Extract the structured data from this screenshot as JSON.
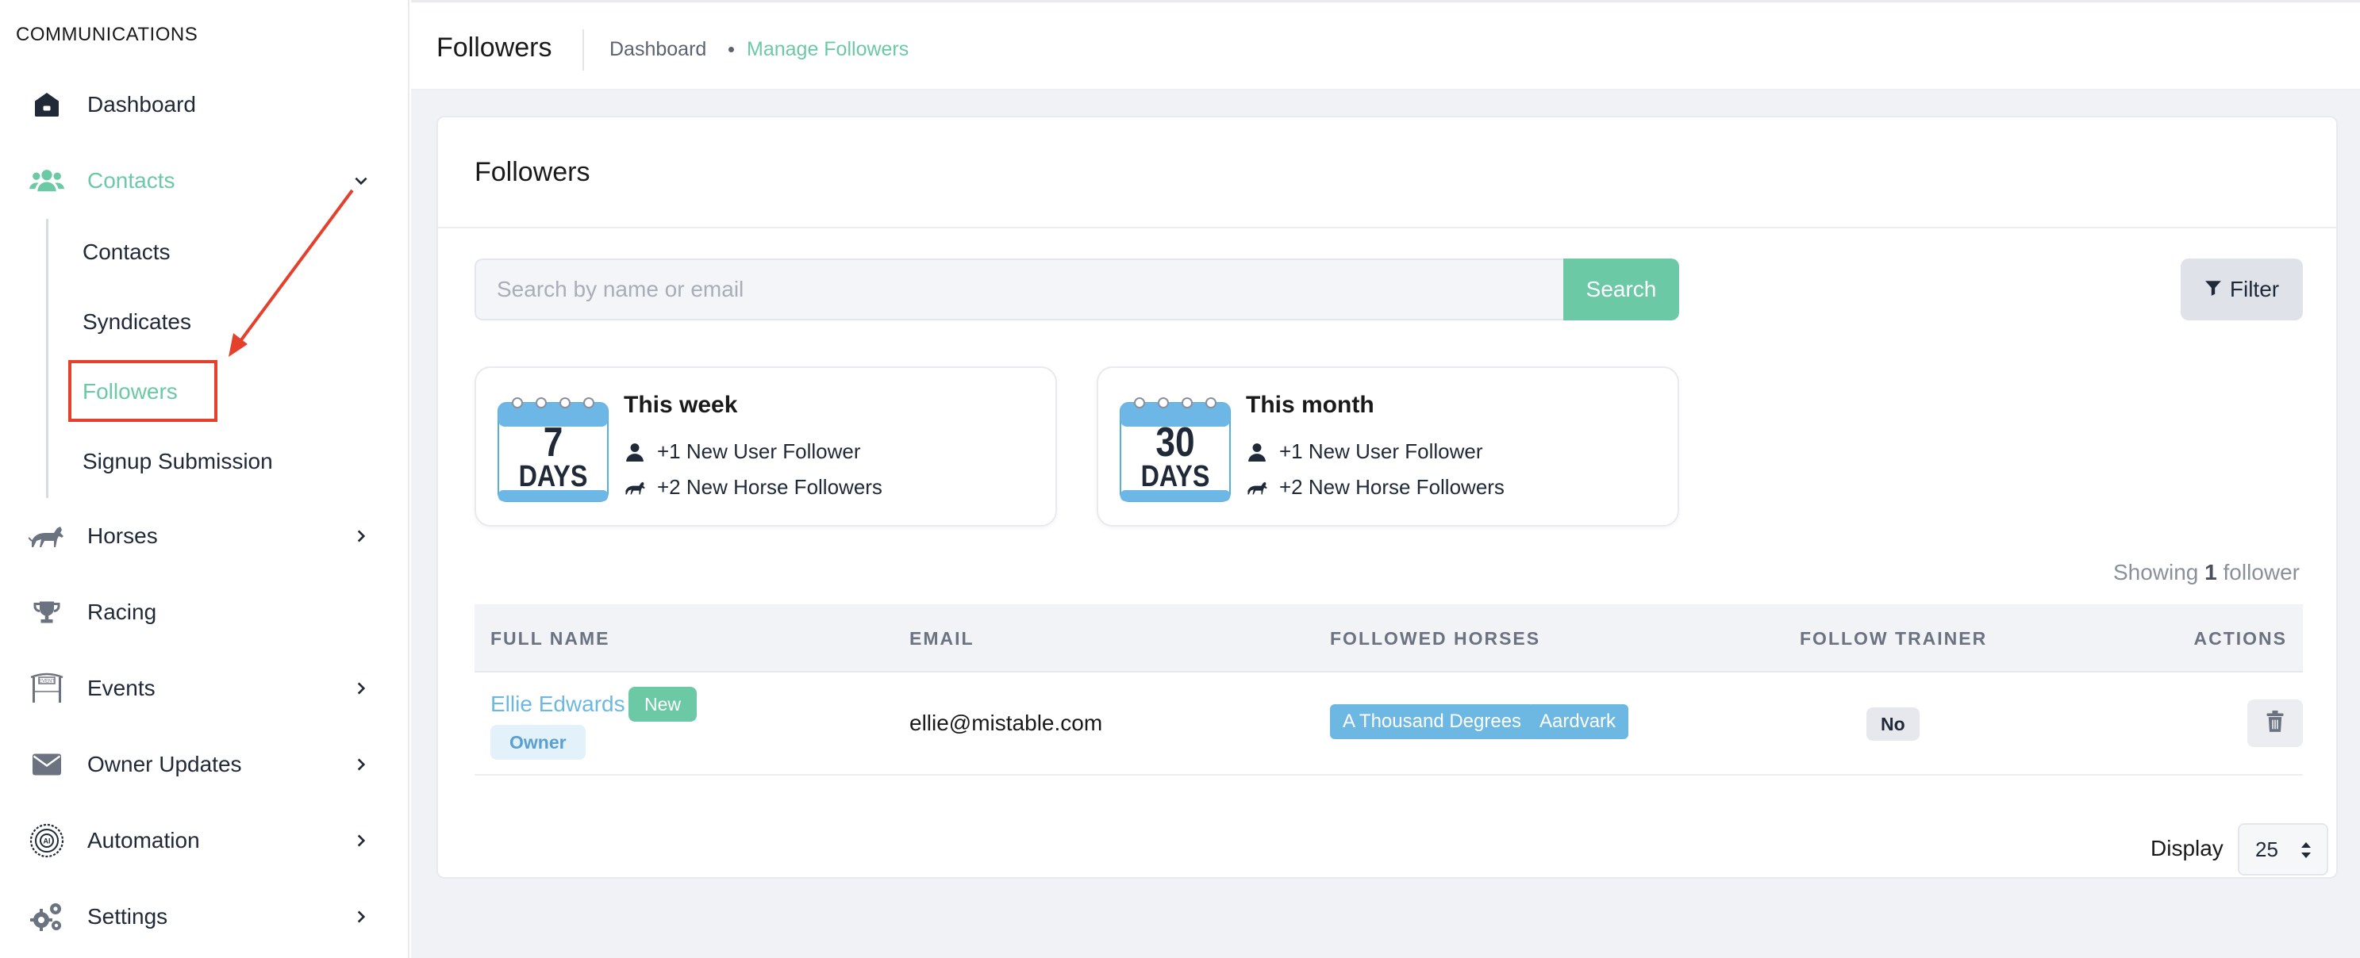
{
  "sidebar": {
    "section_title": "COMMUNICATIONS",
    "items": [
      {
        "label": "Dashboard",
        "icon": "home-icon"
      },
      {
        "label": "Contacts",
        "icon": "users-icon",
        "active": true,
        "expanded": true
      },
      {
        "label": "Horses",
        "icon": "horse-icon"
      },
      {
        "label": "Racing",
        "icon": "trophy-icon"
      },
      {
        "label": "Events",
        "icon": "event-gate-icon"
      },
      {
        "label": "Owner Updates",
        "icon": "envelope-icon"
      },
      {
        "label": "Automation",
        "icon": "automation-icon"
      },
      {
        "label": "Settings",
        "icon": "gears-icon"
      }
    ],
    "sub_items": [
      {
        "label": "Contacts"
      },
      {
        "label": "Syndicates"
      },
      {
        "label": "Followers",
        "active": true
      },
      {
        "label": "Signup Submission"
      }
    ]
  },
  "header": {
    "title": "Followers",
    "breadcrumb": [
      "Dashboard",
      "Manage Followers"
    ]
  },
  "card": {
    "title": "Followers",
    "search": {
      "placeholder": "Search by name or email",
      "button": "Search"
    },
    "filter_button": "Filter",
    "stats": [
      {
        "calendar_number": "7",
        "calendar_unit": "DAYS",
        "title": "This week",
        "user_line": "+1 New User Follower",
        "horse_line": "+2 New Horse Followers"
      },
      {
        "calendar_number": "30",
        "calendar_unit": "DAYS",
        "title": "This month",
        "user_line": "+1 New User Follower",
        "horse_line": "+2 New Horse Followers"
      }
    ],
    "showing": {
      "prefix": "Showing",
      "count": "1",
      "suffix": "follower"
    },
    "table": {
      "columns": [
        "FULL NAME",
        "EMAIL",
        "FOLLOWED HORSES",
        "FOLLOW TRAINER",
        "ACTIONS"
      ],
      "rows": [
        {
          "name": "Ellie Edwards",
          "badge": "New",
          "role": "Owner",
          "email": "ellie@mistable.com",
          "horses": [
            "A Thousand Degrees",
            "Aardvark"
          ],
          "follow_trainer": "No"
        }
      ]
    },
    "display": {
      "label": "Display",
      "value": "25"
    }
  },
  "colors": {
    "accent": "#6cc9a6",
    "link": "#6cb8e2",
    "annotation": "#e4402c"
  }
}
